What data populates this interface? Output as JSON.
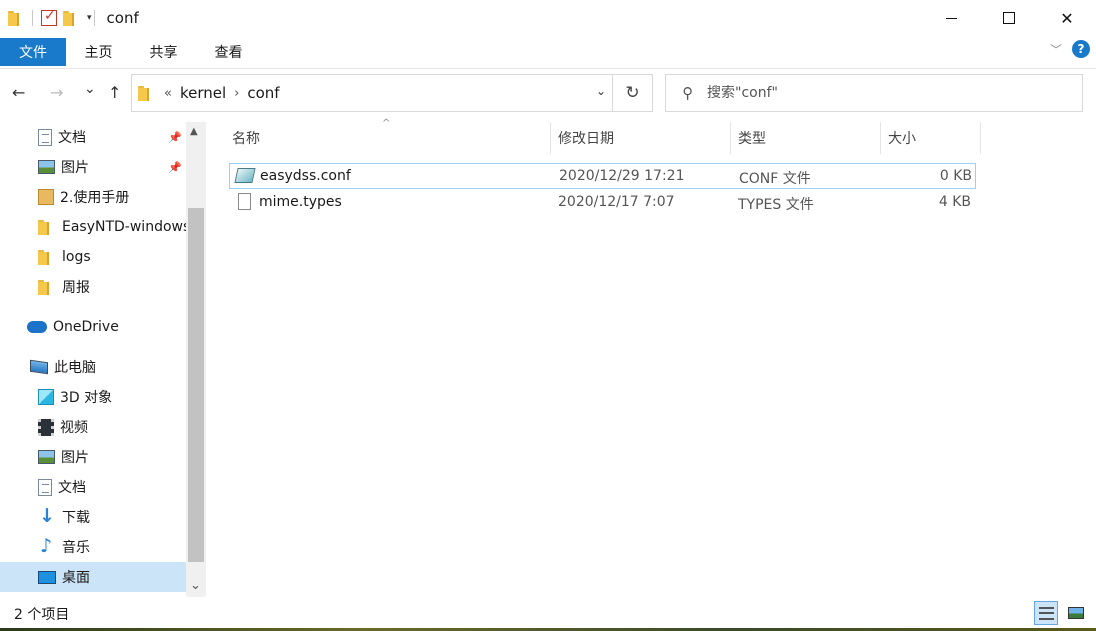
{
  "window": {
    "title": "conf",
    "minimize": "",
    "close": "✕"
  },
  "ribbon": {
    "tabs": [
      "文件",
      "主页",
      "共享",
      "查看"
    ],
    "help": "?"
  },
  "nav": {
    "back": "←",
    "forward": "→",
    "recent": "⌄",
    "up": "↑",
    "overflow": "«",
    "breadcrumb": [
      "kernel",
      "conf"
    ],
    "crumb_sep": "›",
    "dropdown": "⌄",
    "refresh": "↻"
  },
  "search": {
    "placeholder": "搜索\"conf\"",
    "icon": "⚲"
  },
  "sidebar": {
    "quick": [
      {
        "label": "文档",
        "icon": "document-icon",
        "pinned": true
      },
      {
        "label": "图片",
        "icon": "picture-icon",
        "pinned": true
      },
      {
        "label": "2.使用手册",
        "icon": "book-icon",
        "pinned": false
      },
      {
        "label": "EasyNTD-windows",
        "icon": "folder-icon",
        "pinned": false
      },
      {
        "label": "logs",
        "icon": "folder-icon",
        "pinned": false
      },
      {
        "label": "周报",
        "icon": "folder-icon",
        "pinned": false
      }
    ],
    "onedrive": "OneDrive",
    "thispc": "此电脑",
    "pc_items": [
      {
        "label": "3D 对象",
        "icon": "cube-icon"
      },
      {
        "label": "视频",
        "icon": "video-icon"
      },
      {
        "label": "图片",
        "icon": "picture-icon"
      },
      {
        "label": "文档",
        "icon": "document-icon"
      },
      {
        "label": "下载",
        "icon": "download-icon"
      },
      {
        "label": "音乐",
        "icon": "music-icon"
      },
      {
        "label": "桌面",
        "icon": "desktop-icon",
        "selected": true
      }
    ],
    "pin_glyph": "📌",
    "scroll_up": "▲",
    "scroll_down": "⌄"
  },
  "columns": {
    "name": "名称",
    "modified": "修改日期",
    "type": "类型",
    "size": "大小",
    "sort_arrow": "^"
  },
  "files": [
    {
      "name": "easydss.conf",
      "modified": "2020/12/29 17:21",
      "type": "CONF 文件",
      "size": "0 KB",
      "selected": true
    },
    {
      "name": "mime.types",
      "modified": "2020/12/17 7:07",
      "type": "TYPES 文件",
      "size": "4 KB",
      "selected": false
    }
  ],
  "status": {
    "count": "2 个项目"
  },
  "colors": {
    "accent": "#1979ca",
    "selection": "#cce4f7",
    "folder": "#f5c84c"
  }
}
